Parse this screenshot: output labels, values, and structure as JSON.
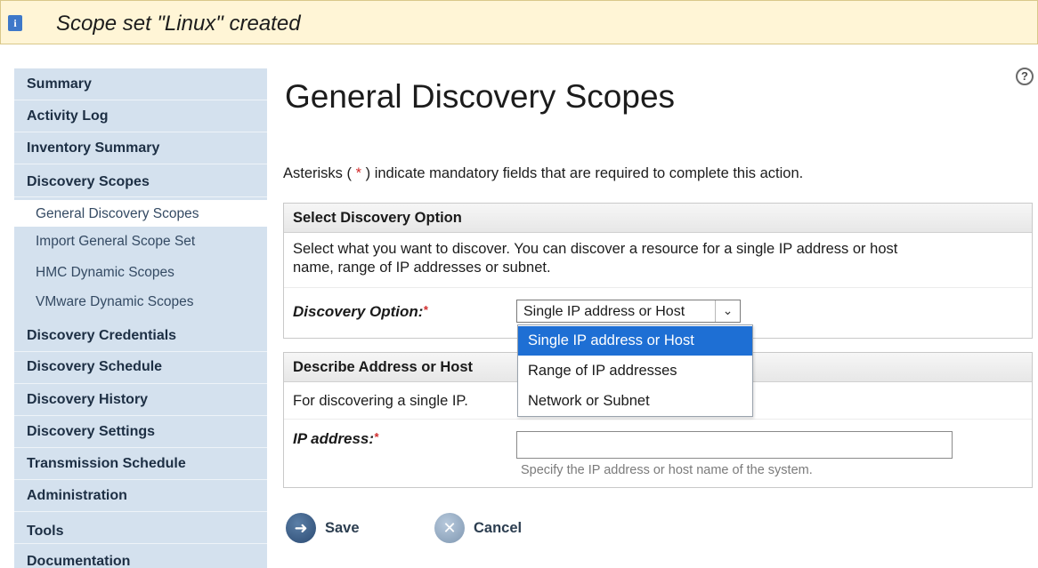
{
  "banner": {
    "message": "Scope set \"Linux\" created",
    "icon": "info-icon"
  },
  "sidebar": {
    "items": [
      {
        "label": "Summary"
      },
      {
        "label": "Activity Log"
      },
      {
        "label": "Inventory Summary"
      },
      {
        "label": "Discovery Scopes"
      },
      {
        "label": "General Discovery Scopes",
        "sub": true,
        "active": true
      },
      {
        "label": "Import General Scope Set",
        "sub": true
      },
      {
        "label": "HMC Dynamic Scopes",
        "sub": true
      },
      {
        "label": "VMware Dynamic Scopes",
        "sub": true
      },
      {
        "label": "Discovery Credentials"
      },
      {
        "label": "Discovery Schedule"
      },
      {
        "label": "Discovery History"
      },
      {
        "label": "Discovery Settings"
      },
      {
        "label": "Transmission Schedule"
      },
      {
        "label": "Administration"
      },
      {
        "label": "Tools"
      },
      {
        "label": "Documentation"
      }
    ]
  },
  "main": {
    "title": "General Discovery Scopes",
    "asterisk_note": {
      "before": "Asterisks (",
      "star": "*",
      "after": ") indicate mandatory fields that are required to complete this action."
    },
    "select_section": {
      "heading": "Select Discovery Option",
      "description_line1": "Select what you want to discover. You can discover a resource for a single IP address or host",
      "description_line2": "name, range of IP addresses or subnet.",
      "field_label": "Discovery Option:",
      "required_mark": "*",
      "selected_value": "Single IP address or Host",
      "options": [
        "Single IP address or Host",
        "Range of IP addresses",
        "Network or Subnet"
      ]
    },
    "address_section": {
      "heading": "Describe Address or Host",
      "description": "For discovering a single IP.",
      "field_label": "IP address:",
      "required_mark": "*",
      "input_value": "",
      "hint": "Specify the IP address or host name of the system."
    },
    "buttons": {
      "save": "Save",
      "cancel": "Cancel"
    }
  },
  "colors": {
    "accent": "#1e6fd4",
    "sidebar_bg": "#d4e1ee",
    "banner_bg": "#fff5d6",
    "required": "#d12b2b"
  }
}
